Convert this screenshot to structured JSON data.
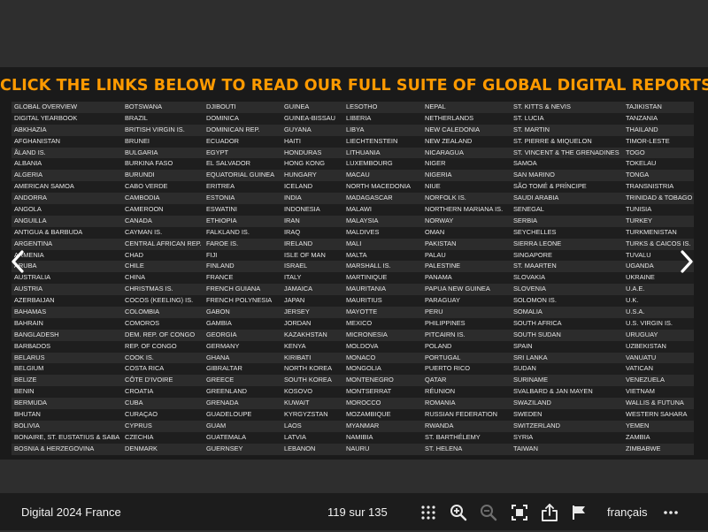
{
  "slide": {
    "heading": "CLICK THE LINKS BELOW TO READ OUR FULL SUITE OF GLOBAL DIGITAL REPORTS",
    "columns": [
      [
        "GLOBAL OVERVIEW",
        "DIGITAL YEARBOOK",
        "ABKHAZIA",
        "AFGHANISTAN",
        "ÅLAND IS.",
        "ALBANIA",
        "ALGERIA",
        "AMERICAN SAMOA",
        "ANDORRA",
        "ANGOLA",
        "ANGUILLA",
        "ANTIGUA & BARBUDA",
        "ARGENTINA",
        "ARMENIA",
        "ARUBA",
        "AUSTRALIA",
        "AUSTRIA",
        "AZERBAIJAN",
        "BAHAMAS",
        "BAHRAIN",
        "BANGLADESH",
        "BARBADOS",
        "BELARUS",
        "BELGIUM",
        "BELIZE",
        "BENIN",
        "BERMUDA",
        "BHUTAN",
        "BOLIVIA",
        "BONAIRE, ST. EUSTATIUS & SABA",
        "BOSNIA & HERZEGOVINA"
      ],
      [
        "BOTSWANA",
        "BRAZIL",
        "BRITISH VIRGIN IS.",
        "BRUNEI",
        "BULGARIA",
        "BURKINA FASO",
        "BURUNDI",
        "CABO VERDE",
        "CAMBODIA",
        "CAMEROON",
        "CANADA",
        "CAYMAN IS.",
        "CENTRAL AFRICAN REP.",
        "CHAD",
        "CHILE",
        "CHINA",
        "CHRISTMAS IS.",
        "COCOS (KEELING) IS.",
        "COLOMBIA",
        "COMOROS",
        "DEM. REP. OF CONGO",
        "REP. OF CONGO",
        "COOK IS.",
        "COSTA RICA",
        "CÔTE D'IVOIRE",
        "CROATIA",
        "CUBA",
        "CURAÇAO",
        "CYPRUS",
        "CZECHIA",
        "DENMARK"
      ],
      [
        "DJIBOUTI",
        "DOMINICA",
        "DOMINICAN REP.",
        "ECUADOR",
        "EGYPT",
        "EL SALVADOR",
        "EQUATORIAL GUINEA",
        "ERITREA",
        "ESTONIA",
        "ESWATINI",
        "ETHIOPIA",
        "FALKLAND IS.",
        "FAROE IS.",
        "FIJI",
        "FINLAND",
        "FRANCE",
        "FRENCH GUIANA",
        "FRENCH POLYNESIA",
        "GABON",
        "GAMBIA",
        "GEORGIA",
        "GERMANY",
        "GHANA",
        "GIBRALTAR",
        "GREECE",
        "GREENLAND",
        "GRENADA",
        "GUADELOUPE",
        "GUAM",
        "GUATEMALA",
        "GUERNSEY"
      ],
      [
        "GUINEA",
        "GUINEA-BISSAU",
        "GUYANA",
        "HAITI",
        "HONDURAS",
        "HONG KONG",
        "HUNGARY",
        "ICELAND",
        "INDIA",
        "INDONESIA",
        "IRAN",
        "IRAQ",
        "IRELAND",
        "ISLE OF MAN",
        "ISRAEL",
        "ITALY",
        "JAMAICA",
        "JAPAN",
        "JERSEY",
        "JORDAN",
        "KAZAKHSTAN",
        "KENYA",
        "KIRIBATI",
        "NORTH KOREA",
        "SOUTH KOREA",
        "KOSOVO",
        "KUWAIT",
        "KYRGYZSTAN",
        "LAOS",
        "LATVIA",
        "LEBANON"
      ],
      [
        "LESOTHO",
        "LIBERIA",
        "LIBYA",
        "LIECHTENSTEIN",
        "LITHUANIA",
        "LUXEMBOURG",
        "MACAU",
        "NORTH MACEDONIA",
        "MADAGASCAR",
        "MALAWI",
        "MALAYSIA",
        "MALDIVES",
        "MALI",
        "MALTA",
        "MARSHALL IS.",
        "MARTINIQUE",
        "MAURITANIA",
        "MAURITIUS",
        "MAYOTTE",
        "MEXICO",
        "MICRONESIA",
        "MOLDOVA",
        "MONACO",
        "MONGOLIA",
        "MONTENEGRO",
        "MONTSERRAT",
        "MOROCCO",
        "MOZAMBIQUE",
        "MYANMAR",
        "NAMIBIA",
        "NAURU"
      ],
      [
        "NEPAL",
        "NETHERLANDS",
        "NEW CALEDONIA",
        "NEW ZEALAND",
        "NICARAGUA",
        "NIGER",
        "NIGERIA",
        "NIUE",
        "NORFOLK IS.",
        "NORTHERN MARIANA IS.",
        "NORWAY",
        "OMAN",
        "PAKISTAN",
        "PALAU",
        "PALESTINE",
        "PANAMA",
        "PAPUA NEW GUINEA",
        "PARAGUAY",
        "PERU",
        "PHILIPPINES",
        "PITCAIRN IS.",
        "POLAND",
        "PORTUGAL",
        "PUERTO RICO",
        "QATAR",
        "RÉUNION",
        "ROMANIA",
        "RUSSIAN FEDERATION",
        "RWANDA",
        "ST. BARTHÉLEMY",
        "ST. HELENA"
      ],
      [
        "ST. KITTS & NEVIS",
        "ST. LUCIA",
        "ST. MARTIN",
        "ST. PIERRE & MIQUELON",
        "ST. VINCENT & THE GRENADINES",
        "SAMOA",
        "SAN MARINO",
        "SÃO TOMÉ & PRÍNCIPE",
        "SAUDI ARABIA",
        "SENEGAL",
        "SERBIA",
        "SEYCHELLES",
        "SIERRA LEONE",
        "SINGAPORE",
        "ST. MAARTEN",
        "SLOVAKIA",
        "SLOVENIA",
        "SOLOMON IS.",
        "SOMALIA",
        "SOUTH AFRICA",
        "SOUTH SUDAN",
        "SPAIN",
        "SRI LANKA",
        "SUDAN",
        "SURINAME",
        "SVALBARD & JAN MAYEN",
        "SWAZILAND",
        "SWEDEN",
        "SWITZERLAND",
        "SYRIA",
        "TAIWAN"
      ],
      [
        "TAJIKISTAN",
        "TANZANIA",
        "THAILAND",
        "TIMOR-LESTE",
        "TOGO",
        "TOKELAU",
        "TONGA",
        "TRANSNISTRIA",
        "TRINIDAD & TOBAGO",
        "TUNISIA",
        "TURKEY",
        "TURKMENISTAN",
        "TURKS & CAICOS IS.",
        "TUVALU",
        "UGANDA",
        "UKRAINE",
        "U.A.E.",
        "U.K.",
        "U.S.A.",
        "U.S. VIRGIN IS.",
        "URUGUAY",
        "UZBEKISTAN",
        "VANUATU",
        "VATICAN",
        "VENEZUELA",
        "VIETNAM",
        "WALLIS & FUTUNA",
        "WESTERN SAHARA",
        "YEMEN",
        "ZAMBIA",
        "ZIMBABWE"
      ]
    ]
  },
  "nav": {
    "prev_icon": "chevron-left-icon",
    "next_icon": "chevron-right-icon"
  },
  "toolbar": {
    "document_title": "Digital 2024 France",
    "page_indicator": "119 sur 135",
    "language": "français",
    "icons": [
      "grid-icon",
      "zoom-in-icon",
      "zoom-out-icon",
      "fit-screen-icon",
      "share-icon",
      "flag-icon",
      "more-icon"
    ]
  },
  "colors": {
    "heading": "#ff9a00",
    "slide_bg": "#1a1a1a",
    "row_alt": "#2c2c2c",
    "bar_bg": "#1c1c1c"
  }
}
